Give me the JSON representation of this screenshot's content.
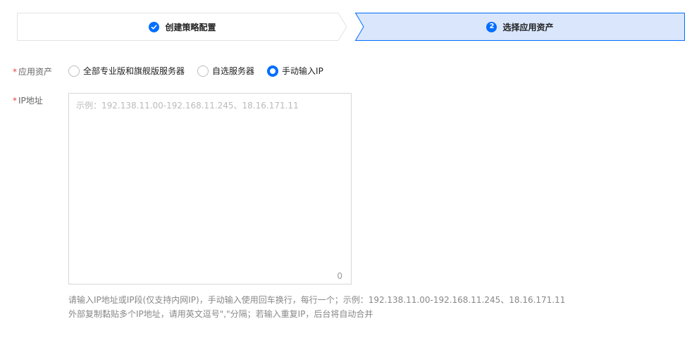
{
  "steps": [
    {
      "label": "创建策略配置",
      "state": "done"
    },
    {
      "number": "2",
      "label": "选择应用资产",
      "state": "active"
    }
  ],
  "colors": {
    "primary": "#006eff",
    "active_step_bg": "#d9e6fc",
    "required_mark": "#e54545"
  },
  "form": {
    "asset": {
      "required_mark": "*",
      "label": "应用资产",
      "options": [
        {
          "label": "全部专业版和旗舰版服务器",
          "checked": false
        },
        {
          "label": "自选服务器",
          "checked": false
        },
        {
          "label": "手动输入IP",
          "checked": true
        }
      ]
    },
    "ip": {
      "required_mark": "*",
      "label": "IP地址",
      "placeholder": "示例：192.138.11.00-192.168.11.245、18.16.171.11",
      "value": "",
      "count": "0",
      "help_line1": "请输入IP地址或IP段(仅支持内网IP)，手动输入使用回车换行，每行一个；示例：192.138.11.00-192.168.11.245、18.16.171.11",
      "help_line2": "外部复制黏贴多个IP地址，请用英文逗号\",\"分隔；若输入重复IP，后台将自动合并"
    }
  }
}
